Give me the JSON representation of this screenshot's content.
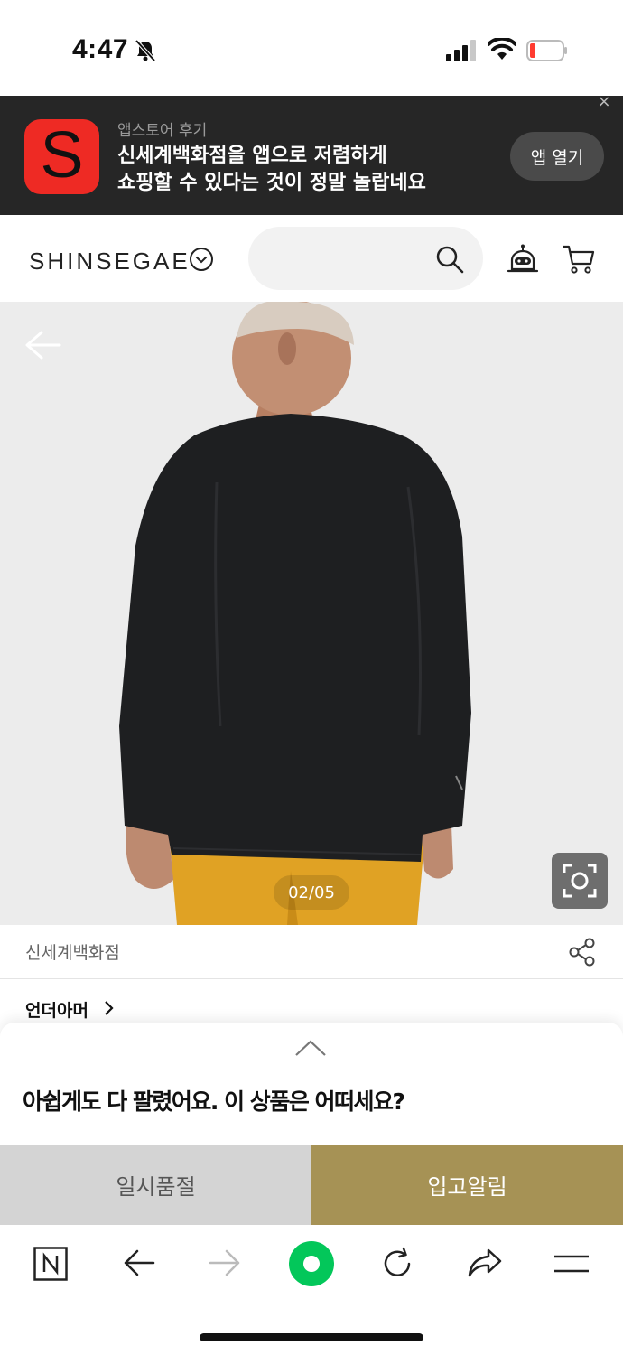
{
  "status_bar": {
    "time": "4:47",
    "icons": [
      "bell-off-icon",
      "cellular-signal-icon",
      "wifi-icon",
      "battery-low-icon"
    ]
  },
  "app_banner": {
    "logo_letter": "S",
    "subtitle": "앱스토어 후기",
    "title_line1": "신세계백화점을 앱으로 저렴하게",
    "title_line2": "쇼핑할 수 있다는 것이 정말 놀랍네요",
    "open_button": "앱 열기",
    "close_glyph": "×",
    "logo_color": "#ee2a24"
  },
  "header": {
    "brand": "SHINSEGAE",
    "search_placeholder": "",
    "icons": [
      "chevron-down-circle-icon",
      "search-icon",
      "chatbot-icon",
      "cart-icon"
    ]
  },
  "product": {
    "image_counter": "02/05",
    "seller": "신세계백화점",
    "brand": "언더아머"
  },
  "sold_out_sheet": {
    "message": "아쉽게도 다 팔렸어요. 이 상품은 어떠세요?",
    "sold_out_button": "일시품절",
    "notify_button": "입고알림",
    "notify_color": "#a69255"
  },
  "browser_toolbar": {
    "items": [
      "naver-home-icon",
      "back-icon",
      "forward-icon",
      "green-dot-icon",
      "reload-icon",
      "share-icon",
      "menu-icon"
    ],
    "accent": "#03c75a"
  }
}
